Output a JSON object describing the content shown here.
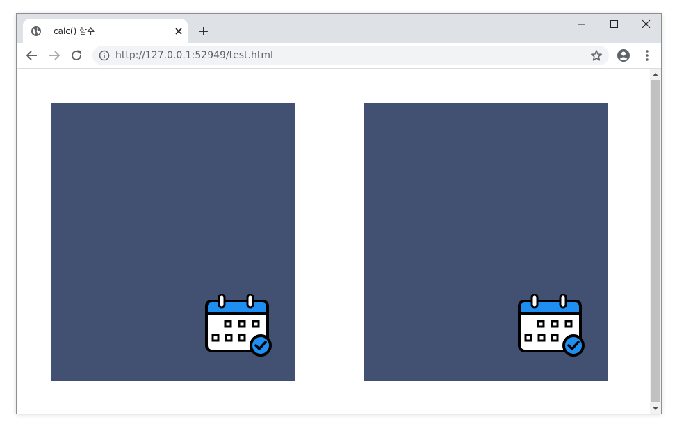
{
  "tab": {
    "title": "calc() 함수",
    "favicon": "globe-icon"
  },
  "window_controls": [
    "minimize-icon",
    "maximize-icon",
    "close-icon"
  ],
  "address_bar": {
    "url": "http://127.0.0.1:52949/test.html"
  },
  "content": {
    "boxes": [
      {
        "icon": "calendar-check-icon"
      },
      {
        "icon": "calendar-check-icon"
      }
    ]
  },
  "colors": {
    "box_background": "#425172",
    "calendar_header": "#1e8ff0",
    "check_badge": "#1e8ff0",
    "outline": "#000000",
    "titlebar": "#dee1e6",
    "omnibox": "#f1f3f4"
  }
}
